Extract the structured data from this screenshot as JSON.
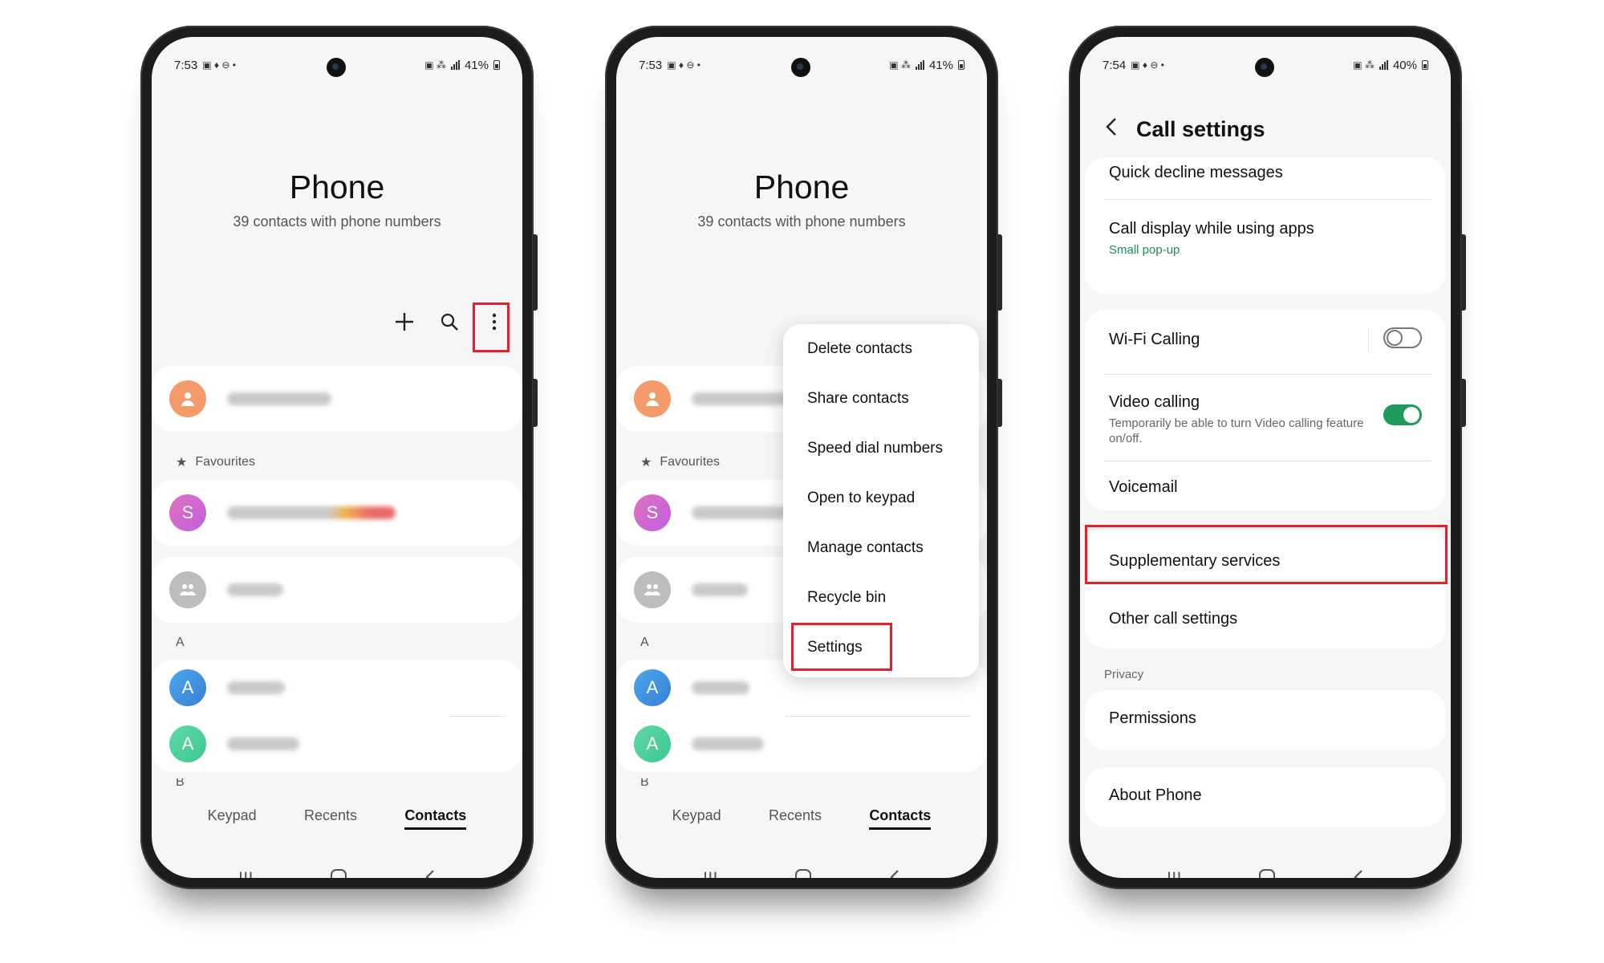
{
  "phone1": {
    "status": {
      "time": "7:53",
      "battery": "41%"
    },
    "title": "Phone",
    "subtitle": "39 contacts with phone numbers",
    "toolbar": {
      "add_icon": "plus-icon",
      "search_icon": "search-icon",
      "more_icon": "more-vertical-icon"
    },
    "contacts": {
      "me_initial": "",
      "favourites_label": "Favourites",
      "fav_initial": "S",
      "section_a": "A",
      "a1_initial": "A",
      "a2_initial": "A",
      "section_b": "B"
    },
    "tabs": [
      "Keypad",
      "Recents",
      "Contacts"
    ],
    "active_tab": "Contacts"
  },
  "phone2": {
    "status": {
      "time": "7:53",
      "battery": "41%"
    },
    "title": "Phone",
    "subtitle": "39 contacts with phone numbers",
    "contacts": {
      "favourites_label": "Favourites",
      "fav_initial": "S",
      "section_a": "A",
      "a1_initial": "A",
      "a2_initial": "A",
      "section_b": "B"
    },
    "menu": [
      "Delete contacts",
      "Share contacts",
      "Speed dial numbers",
      "Open to keypad",
      "Manage contacts",
      "Recycle bin",
      "Settings"
    ],
    "tabs": [
      "Keypad",
      "Recents",
      "Contacts"
    ]
  },
  "phone3": {
    "status": {
      "time": "7:54",
      "battery": "40%"
    },
    "title": "Call settings",
    "items": {
      "quick_decline": "Quick decline messages",
      "call_display": "Call display while using apps",
      "call_display_sub": "Small pop-up",
      "wifi_calling": "Wi-Fi Calling",
      "video_calling": "Video calling",
      "video_calling_sub": "Temporarily be able to turn Video calling feature on/off.",
      "voicemail": "Voicemail",
      "supplementary": "Supplementary services",
      "other_call": "Other call settings",
      "privacy_label": "Privacy",
      "permissions": "Permissions",
      "about": "About Phone"
    },
    "toggles": {
      "wifi_calling": false,
      "video_calling": true
    }
  },
  "colors": {
    "highlight": "#e5202a",
    "accent_green": "#1d9a5c"
  }
}
